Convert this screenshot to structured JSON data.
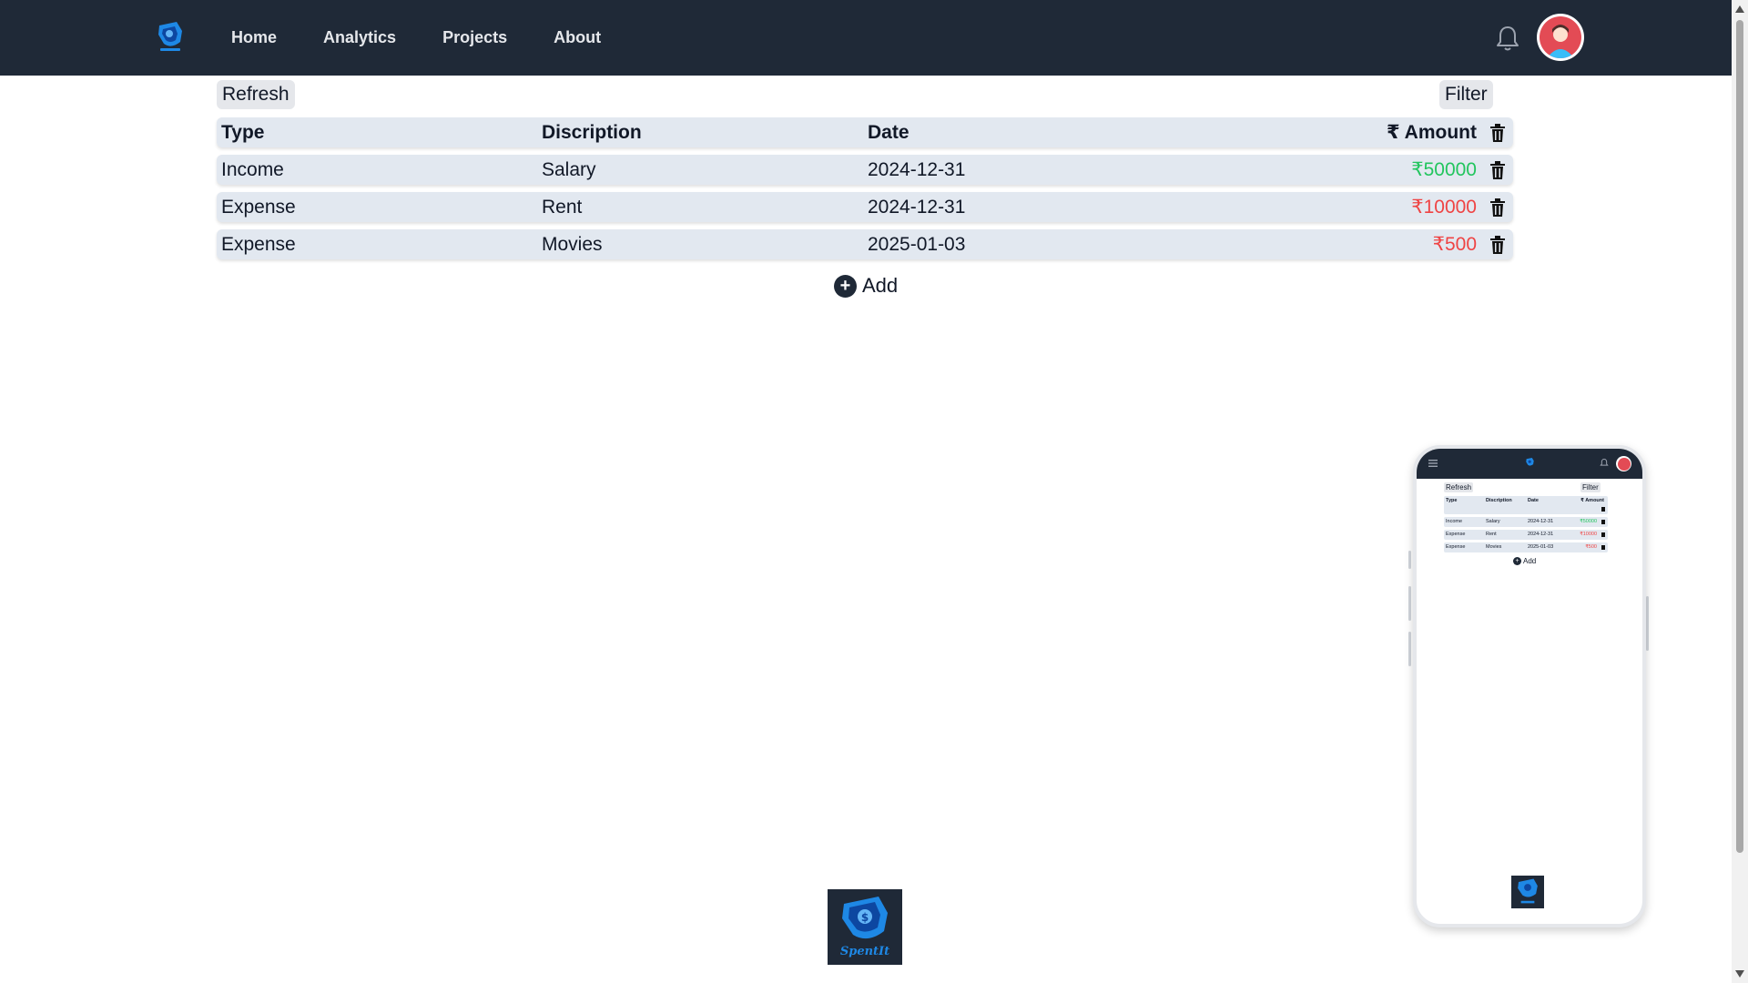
{
  "nav": {
    "links": [
      "Home",
      "Analytics",
      "Projects",
      "About"
    ],
    "icons": {
      "logo": "spentit-logo",
      "bell": "bell-icon",
      "avatar": "user-avatar"
    }
  },
  "toolbar": {
    "refresh_label": "Refresh",
    "filter_label": "Filter"
  },
  "table": {
    "headers": {
      "type": "Type",
      "description": "Discription",
      "date": "Date",
      "amount": "₹ Amount"
    },
    "rows": [
      {
        "type": "Income",
        "description": "Salary",
        "date": "2024-12-31",
        "amount": "₹50000",
        "kind": "income"
      },
      {
        "type": "Expense",
        "description": "Rent",
        "date": "2024-12-31",
        "amount": "₹10000",
        "kind": "expense"
      },
      {
        "type": "Expense",
        "description": "Movies",
        "date": "2025-01-03",
        "amount": "₹500",
        "kind": "expense"
      }
    ]
  },
  "add": {
    "label": "Add",
    "symbol": "+"
  },
  "footer": {
    "brand": "SpentIt"
  },
  "colors": {
    "nav_bg": "#1f2937",
    "income": "#22c55e",
    "expense": "#ef4444",
    "row_bg": "#e2e8f0",
    "logo_blue": "#1e88e5"
  }
}
